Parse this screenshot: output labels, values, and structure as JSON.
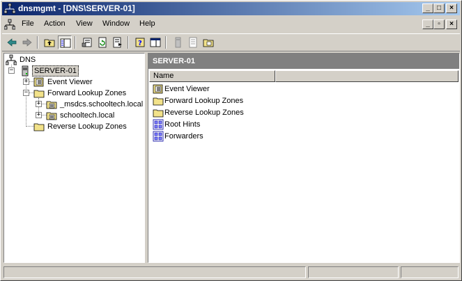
{
  "window": {
    "title": "dnsmgmt - [DNS\\SERVER-01]"
  },
  "menu": {
    "items": [
      "File",
      "Action",
      "View",
      "Window",
      "Help"
    ]
  },
  "tree": {
    "root": "DNS",
    "server": "SERVER-01",
    "event_viewer": "Event Viewer",
    "forward_zones": "Forward Lookup Zones",
    "zone1": "_msdcs.schooltech.local",
    "zone2": "schooltech.local",
    "reverse_zones": "Reverse Lookup Zones"
  },
  "right": {
    "header": "SERVER-01",
    "column_name": "Name",
    "items": [
      "Event Viewer",
      "Forward Lookup Zones",
      "Reverse Lookup Zones",
      "Root Hints",
      "Forwarders"
    ]
  },
  "icons": [
    "dns-icon",
    "back-icon",
    "forward-icon",
    "up-folder-icon",
    "show-tree-icon",
    "properties-icon",
    "refresh-icon",
    "export-icon",
    "help-icon",
    "console-tree-icon",
    "server-icon",
    "log-icon",
    "zone-icon",
    "folder-icon",
    "roothints-icon"
  ],
  "colors": {
    "title_start": "#0a246a",
    "title_end": "#a6caf0",
    "pane_header": "#808080",
    "face": "#d4d0c8"
  }
}
